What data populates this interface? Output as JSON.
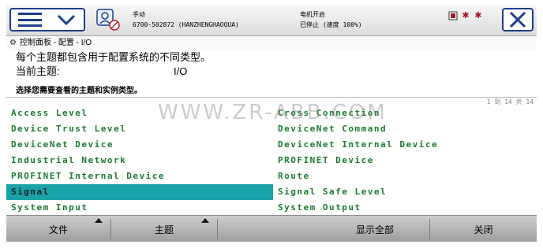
{
  "header": {
    "mode": "手动",
    "controller": "6700-502872 (HANZHENGHAOQUA)",
    "motor": "电机开启",
    "state": "已停止 (速度 100%)"
  },
  "breadcrumb": "控制面板 - 配置 - I/O",
  "description": {
    "line1": "每个主题都包含用于配置系统的不同类型。",
    "current_topic_label": "当前主题:",
    "current_topic_value": "I/O",
    "instruction": "选择您需要查看的主题和实例类型。"
  },
  "pager": "1 到 14 共 14",
  "list": {
    "left": [
      "Access Level",
      "Device Trust Level",
      "DeviceNet Device",
      "Industrial Network",
      "PROFINET Internal Device",
      "Signal",
      "System Input"
    ],
    "right": [
      "Cross Connection",
      "DeviceNet Command",
      "DeviceNet Internal Device",
      "PROFINET Device",
      "Route",
      "Signal Safe Level",
      "System Output"
    ],
    "selected": "Signal"
  },
  "watermark": "WWW.ZR-ABB.COM",
  "toolbar": {
    "file": "文件",
    "topic": "主题",
    "show_all": "显示全部",
    "close": "关闭"
  },
  "colors": {
    "list_text": "#1c7a34",
    "selection": "#1aa3a8",
    "frame_blue": "#1d3f8a"
  }
}
